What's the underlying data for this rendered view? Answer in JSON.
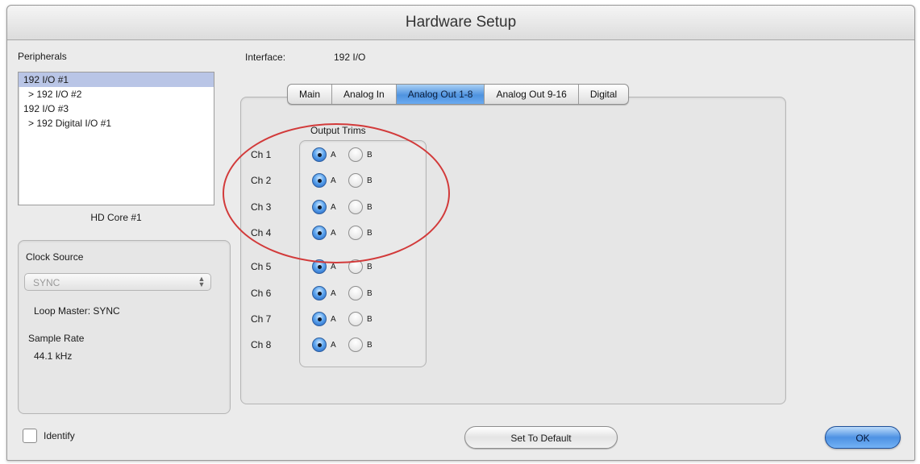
{
  "window": {
    "title": "Hardware Setup"
  },
  "peripherals": {
    "label": "Peripherals",
    "items": [
      "192 I/O #1",
      "> 192 I/O #2",
      "192 I/O #3",
      "> 192 Digital I/O #1"
    ],
    "selected_index": 0,
    "core_label": "HD Core #1"
  },
  "clock": {
    "label": "Clock Source",
    "source_value": "SYNC",
    "loop_master": "Loop Master: SYNC",
    "sample_rate_label": "Sample Rate",
    "sample_rate_value": "44.1 kHz"
  },
  "interface": {
    "label": "Interface:",
    "value": "192 I/O"
  },
  "tabs": [
    "Main",
    "Analog In",
    "Analog Out 1-8",
    "Analog Out 9-16",
    "Digital"
  ],
  "active_tab_index": 2,
  "output_trims": {
    "label": "Output Trims",
    "option_a": "A",
    "option_b": "B",
    "channels": [
      {
        "label": "Ch 1",
        "selected": "A"
      },
      {
        "label": "Ch 2",
        "selected": "A"
      },
      {
        "label": "Ch 3",
        "selected": "A"
      },
      {
        "label": "Ch 4",
        "selected": "A"
      },
      {
        "label": "Ch 5",
        "selected": "A"
      },
      {
        "label": "Ch 6",
        "selected": "A"
      },
      {
        "label": "Ch 7",
        "selected": "A"
      },
      {
        "label": "Ch 8",
        "selected": "A"
      }
    ]
  },
  "footer": {
    "identify_label": "Identify",
    "identify_checked": false,
    "set_default_label": "Set To Default",
    "ok_label": "OK"
  },
  "colors": {
    "selected_radio": "#3d82dc",
    "highlight_circle": "#d23a3a",
    "selection_bg": "#b9c5e6"
  }
}
